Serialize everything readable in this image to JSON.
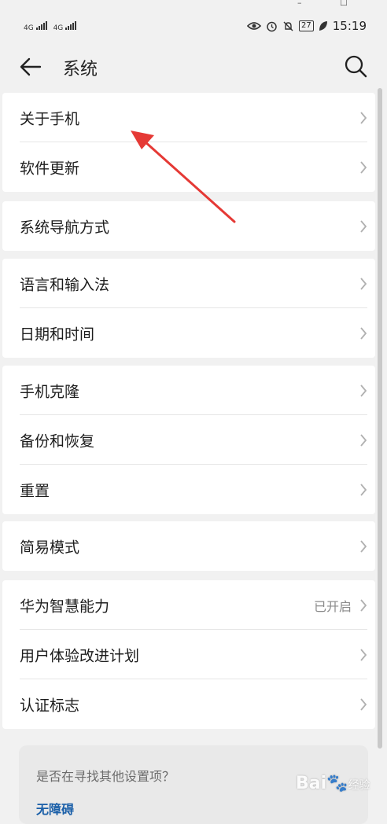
{
  "window_controls": {
    "minimize": "–",
    "maximize": "☐"
  },
  "status_bar": {
    "sim1": "4G",
    "sim2": "4G",
    "battery": "27",
    "time": "15:19"
  },
  "app_bar": {
    "title": "系统"
  },
  "groups": [
    {
      "items": [
        {
          "label": "关于手机"
        },
        {
          "label": "软件更新"
        }
      ]
    },
    {
      "items": [
        {
          "label": "系统导航方式"
        }
      ]
    },
    {
      "items": [
        {
          "label": "语言和输入法"
        },
        {
          "label": "日期和时间"
        }
      ]
    },
    {
      "items": [
        {
          "label": "手机克隆"
        },
        {
          "label": "备份和恢复"
        },
        {
          "label": "重置"
        }
      ]
    },
    {
      "items": [
        {
          "label": "简易模式"
        }
      ]
    },
    {
      "items": [
        {
          "label": "华为智慧能力",
          "value": "已开启"
        },
        {
          "label": "用户体验改进计划"
        },
        {
          "label": "认证标志"
        }
      ]
    }
  ],
  "hint": {
    "question": "是否在寻找其他设置项？",
    "link": "无障碍"
  },
  "watermark": {
    "text": "Bai",
    "suffix": "经验"
  },
  "colors": {
    "background": "#f1f1f1",
    "card": "#ffffff",
    "link": "#1a5fa8",
    "annotation_arrow": "#e53935"
  }
}
